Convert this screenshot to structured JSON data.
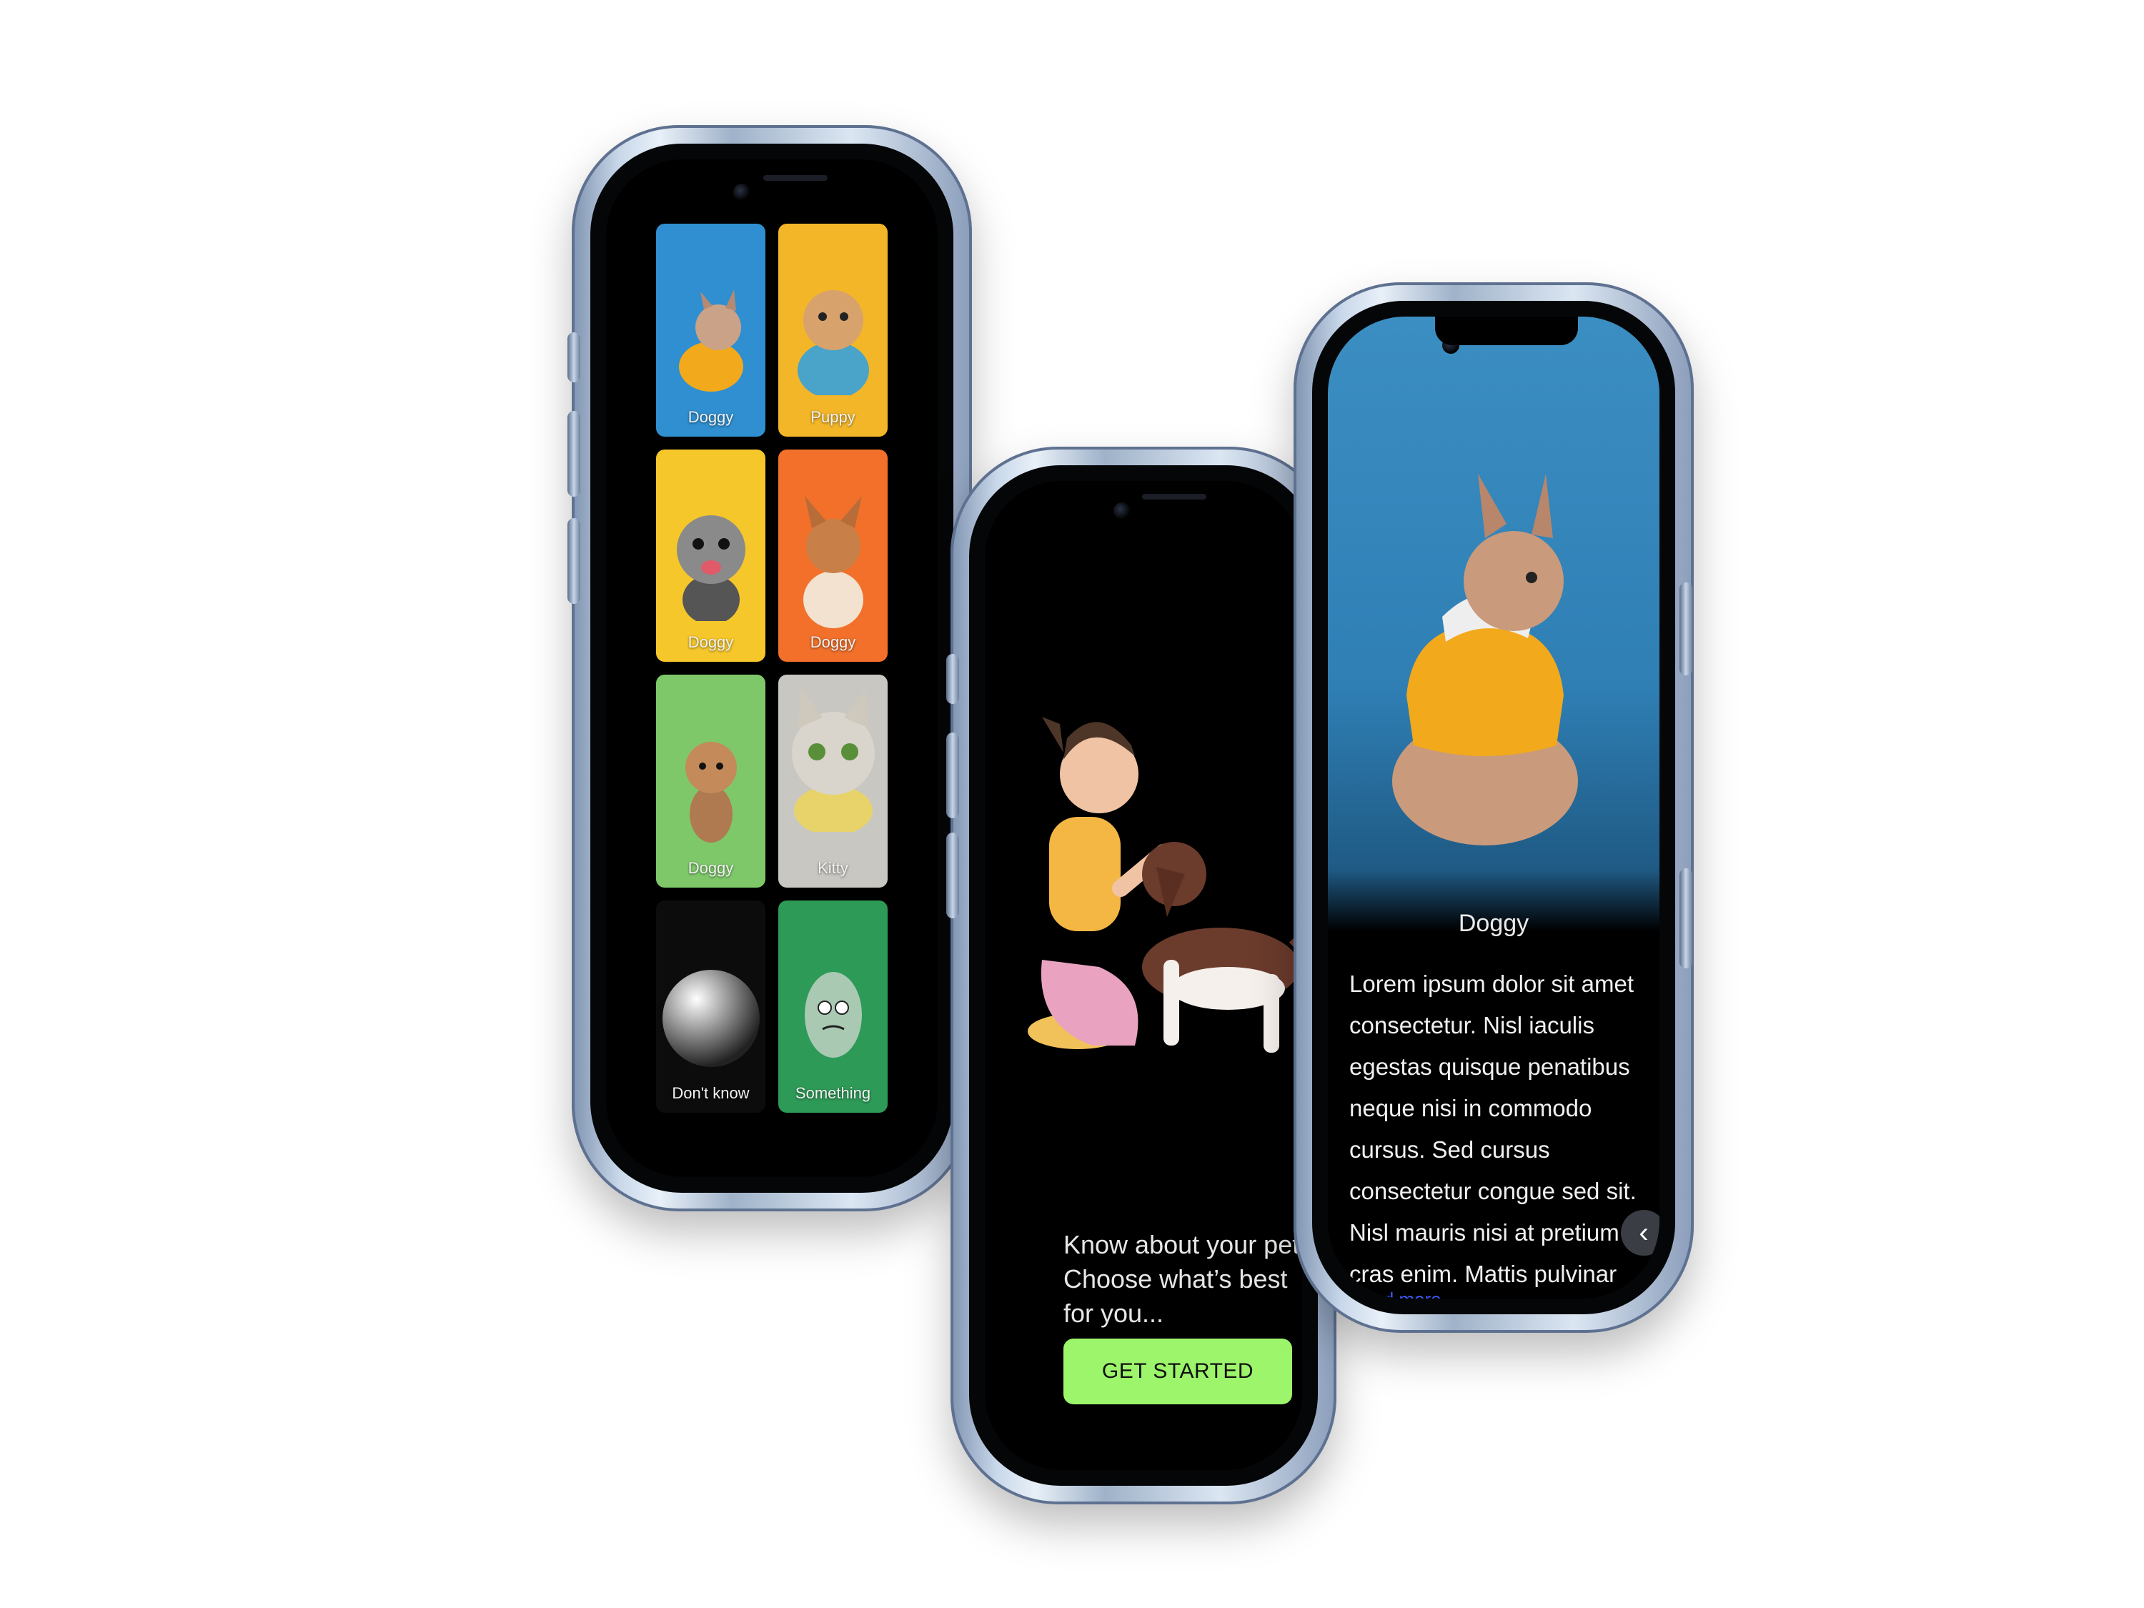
{
  "grid_screen": {
    "tiles": [
      {
        "label": "Doggy",
        "color": "#2f8fd0"
      },
      {
        "label": "Puppy",
        "color": "#f2b628"
      },
      {
        "label": "Doggy",
        "color": "#f6c72b"
      },
      {
        "label": "Doggy",
        "color": "#f2702a"
      },
      {
        "label": "Doggy",
        "color": "#7ec86a"
      },
      {
        "label": "Kitty",
        "color": "#c9c7c2"
      },
      {
        "label": "Don't know",
        "color": "#0c0c0c"
      },
      {
        "label": "Something",
        "color": "#2d9a57"
      }
    ]
  },
  "intro_screen": {
    "line1": "Know about your pet",
    "line2": "Choose what’s best for you...",
    "cta_label": "GET STARTED",
    "cta_color": "#9cf56a"
  },
  "detail_screen": {
    "pet_name": "Doggy",
    "description": "Lorem ipsum dolor sit amet consectetur. Nisl iaculis egestas quisque penatibus neque nisi in commodo cursus. Sed cursus consectetur congue sed sit. Nisl mauris nisi at pretium in cras enim. Mattis pulvinar sdf asdf asdf sdf sdf sdf amet posuere",
    "read_more": "Read more...",
    "back_icon": "chevron-left-icon"
  }
}
